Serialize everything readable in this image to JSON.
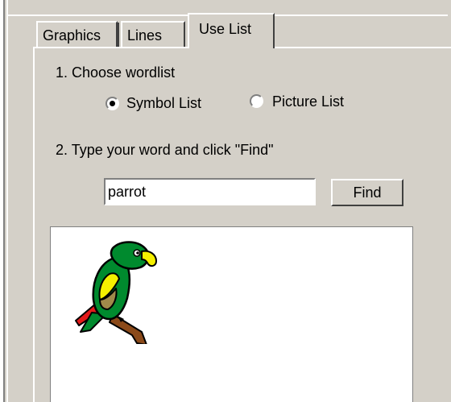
{
  "tabs": [
    {
      "label": "Graphics",
      "active": false
    },
    {
      "label": "Lines",
      "active": false
    },
    {
      "label": "Use List",
      "active": true
    }
  ],
  "step1": {
    "label": "1. Choose wordlist",
    "options": [
      {
        "label": "Symbol List",
        "selected": true
      },
      {
        "label": "Picture List",
        "selected": false
      }
    ]
  },
  "step2": {
    "label": "2. Type your word and click \"Find\"",
    "input_value": "parrot",
    "button_label": "Find"
  },
  "results": {
    "items": [
      {
        "icon": "parrot-icon"
      }
    ]
  },
  "colors": {
    "window_bg": "#d4d0c8",
    "parrot_green": "#008a2e",
    "parrot_yellow": "#f5f000",
    "parrot_red": "#e21a1a",
    "branch_brown": "#8b4a1a"
  }
}
